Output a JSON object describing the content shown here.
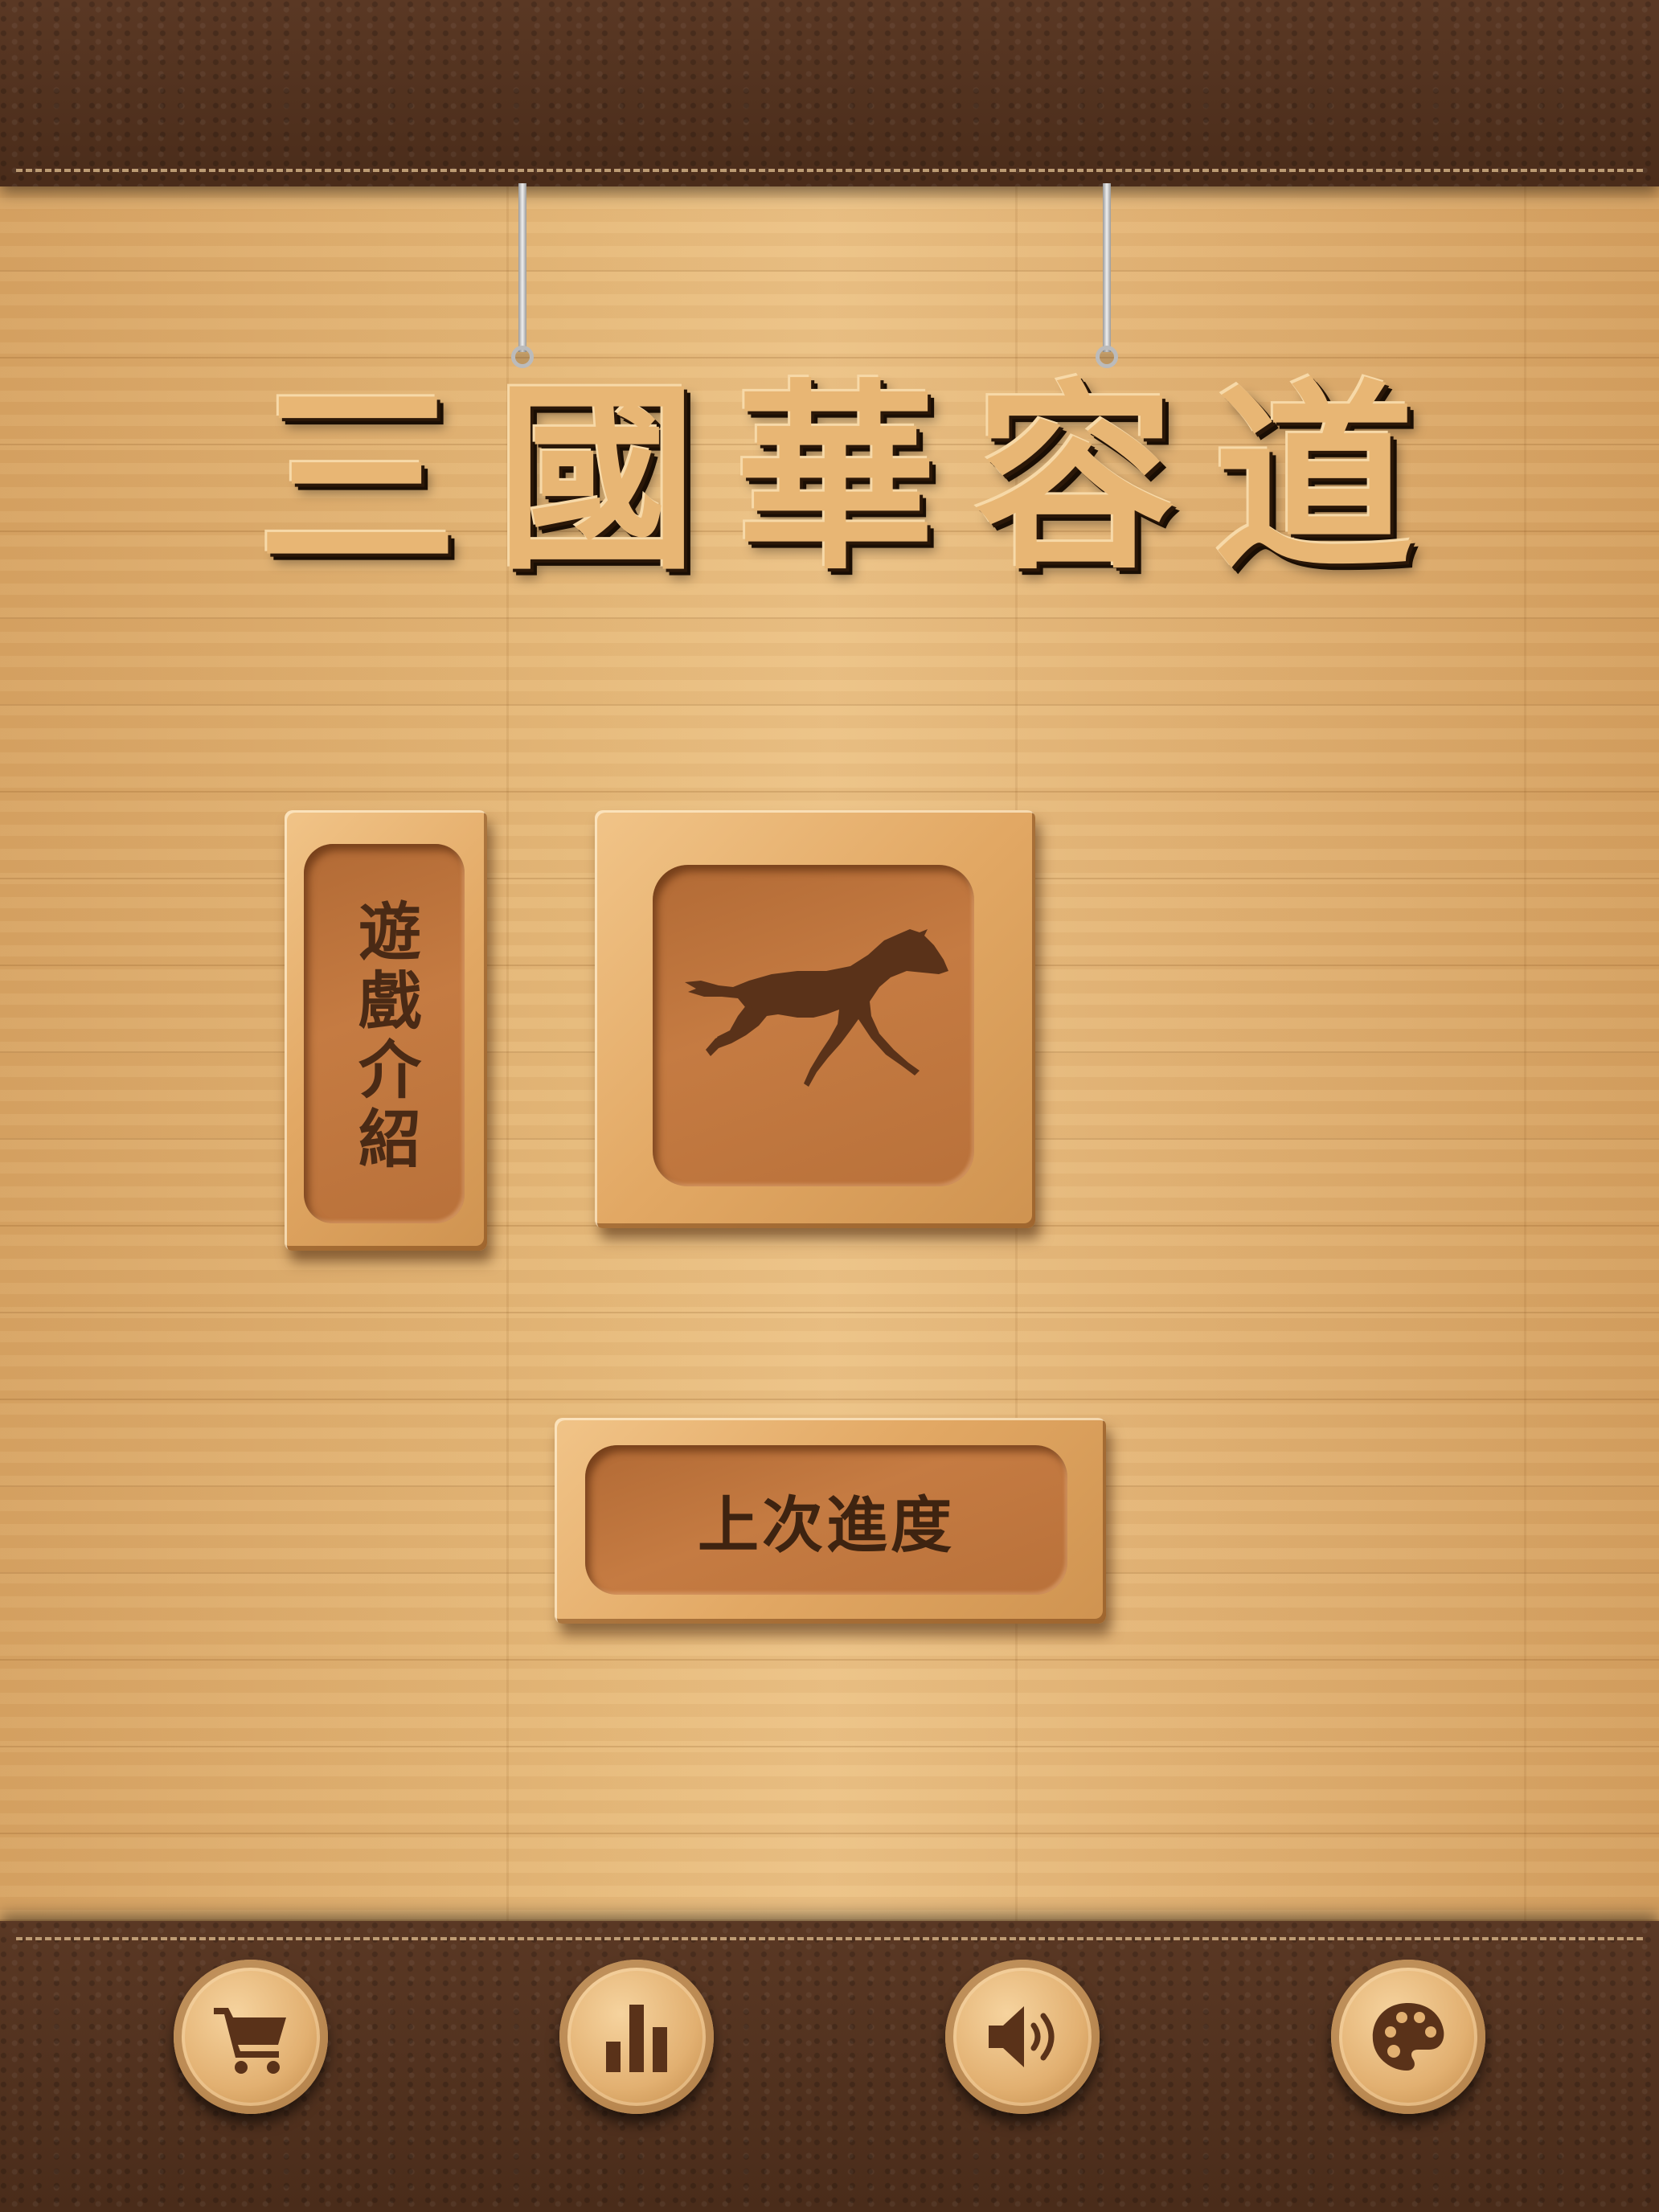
{
  "title": {
    "chars": [
      "三",
      "國",
      "華",
      "容",
      "道"
    ]
  },
  "menu": {
    "intro_label": "遊戲介紹",
    "play_icon": "horse-icon",
    "resume_label": "上次進度"
  },
  "bottom_bar": {
    "items": [
      {
        "icon": "shopping-cart-icon"
      },
      {
        "icon": "bar-chart-icon"
      },
      {
        "icon": "speaker-icon"
      },
      {
        "icon": "palette-icon"
      }
    ]
  },
  "colors": {
    "wood": "#e6b97a",
    "leather": "#4a2c1a",
    "carved_text": "#4a2a15",
    "icon_brown": "#5a3219"
  }
}
